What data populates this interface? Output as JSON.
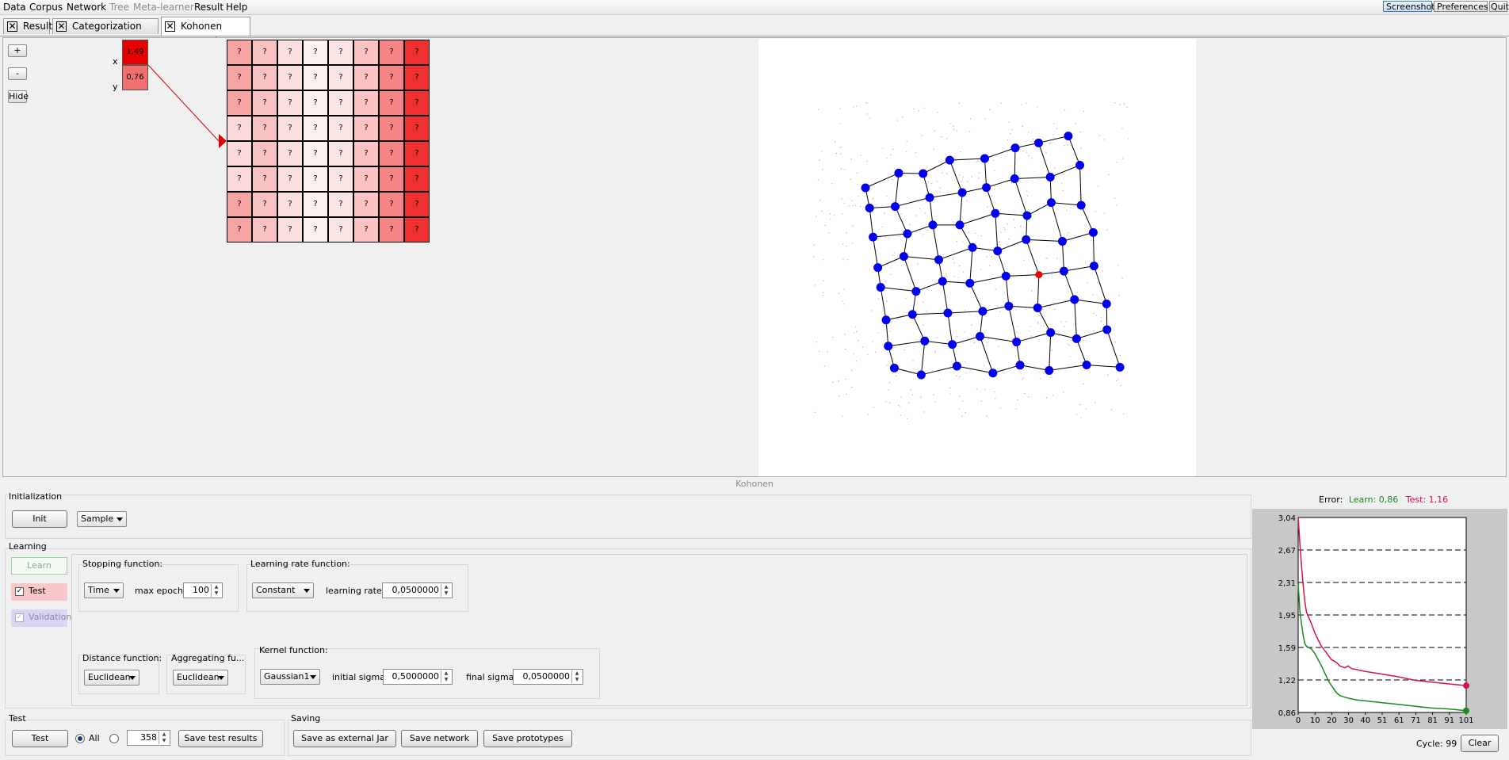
{
  "menu": [
    "Data",
    "Corpus",
    "Network",
    "Tree",
    "Meta-learner",
    "Result",
    "Help"
  ],
  "menu_disabled": [
    "Tree",
    "Meta-learner"
  ],
  "top_buttons": {
    "screenshot": "Screenshot",
    "preferences": "Preferences",
    "quit": "Quit"
  },
  "tabs": [
    "Result",
    "Categorization Corpus",
    "Kohonen Network"
  ],
  "side": {
    "plus": "+",
    "minus": "-",
    "hide": "Hide"
  },
  "input": {
    "x_label": "x",
    "y_label": "y",
    "x_value": "1,49",
    "y_value": "0,76"
  },
  "grid_placeholder": "?",
  "panel_title": "Kohonen",
  "init": {
    "label": "Initialization",
    "button": "Init",
    "method": "Sample"
  },
  "learning": {
    "label": "Learning",
    "learn": "Learn",
    "test": "Test",
    "validation": "Validation",
    "stopping_label": "Stopping function:",
    "stopping": "Time",
    "max_epoch_label": "max epoch:",
    "max_epoch": "100",
    "lr_label": "Learning rate function:",
    "lr": "Constant",
    "lr_value_label": "learning rate:",
    "lr_value": "0,0500000",
    "distance_label": "Distance function:",
    "distance": "Euclidean",
    "aggregating_label": "Aggregating fu...",
    "aggregating": "Euclidean",
    "kernel_label": "Kernel function:",
    "kernel": "Gaussian1",
    "initial_sigma_label": "initial sigma:",
    "initial_sigma": "0,5000000",
    "final_sigma_label": "final sigma:",
    "final_sigma": "0,0500000"
  },
  "test": {
    "label": "Test",
    "button": "Test",
    "all": "All",
    "count": "358",
    "save": "Save test results"
  },
  "saving": {
    "label": "Saving",
    "jar": "Save as external Jar",
    "network": "Save network",
    "prototypes": "Save prototypes"
  },
  "error": {
    "prefix": "Error:",
    "learn": "Learn: 0,86",
    "test": "Test: 1,16"
  },
  "cycle": "Cycle: 99",
  "clear": "Clear",
  "colors": {
    "learn": "#1b8a1b",
    "test": "#d4124a",
    "node": "#0000ee",
    "winner": "#ee0000"
  },
  "chart_data": {
    "type": "line",
    "x_ticks": [
      "0",
      "10",
      "20",
      "30",
      "40",
      "51",
      "61",
      "71",
      "81",
      "91",
      "101"
    ],
    "y_ticks": [
      "0,86",
      "1,22",
      "1,59",
      "1,95",
      "2,31",
      "2,67",
      "3,04"
    ],
    "ylim": [
      0.86,
      3.04
    ],
    "xlim": [
      0,
      101
    ],
    "grid": "dashed horizontal",
    "series": [
      {
        "name": "Learn",
        "x": [
          0,
          1,
          2,
          3,
          4,
          5,
          8,
          10,
          12,
          14,
          16,
          18,
          20,
          23,
          25,
          28,
          30,
          35,
          40,
          50,
          60,
          70,
          80,
          90,
          101
        ],
        "y": [
          2.3,
          2.0,
          1.85,
          1.72,
          1.63,
          1.6,
          1.57,
          1.52,
          1.45,
          1.38,
          1.3,
          1.22,
          1.16,
          1.08,
          1.05,
          1.03,
          1.02,
          1.0,
          0.99,
          0.97,
          0.95,
          0.93,
          0.91,
          0.9,
          0.88
        ]
      },
      {
        "name": "Test",
        "x": [
          0,
          1,
          2,
          3,
          4,
          5,
          8,
          10,
          12,
          14,
          16,
          18,
          20,
          23,
          25,
          28,
          30,
          32,
          35,
          40,
          50,
          60,
          70,
          80,
          90,
          101
        ],
        "y": [
          3.04,
          2.75,
          2.5,
          2.28,
          2.1,
          1.98,
          1.85,
          1.75,
          1.67,
          1.6,
          1.55,
          1.5,
          1.45,
          1.42,
          1.38,
          1.36,
          1.38,
          1.35,
          1.34,
          1.32,
          1.29,
          1.26,
          1.22,
          1.2,
          1.18,
          1.16
        ]
      }
    ]
  }
}
